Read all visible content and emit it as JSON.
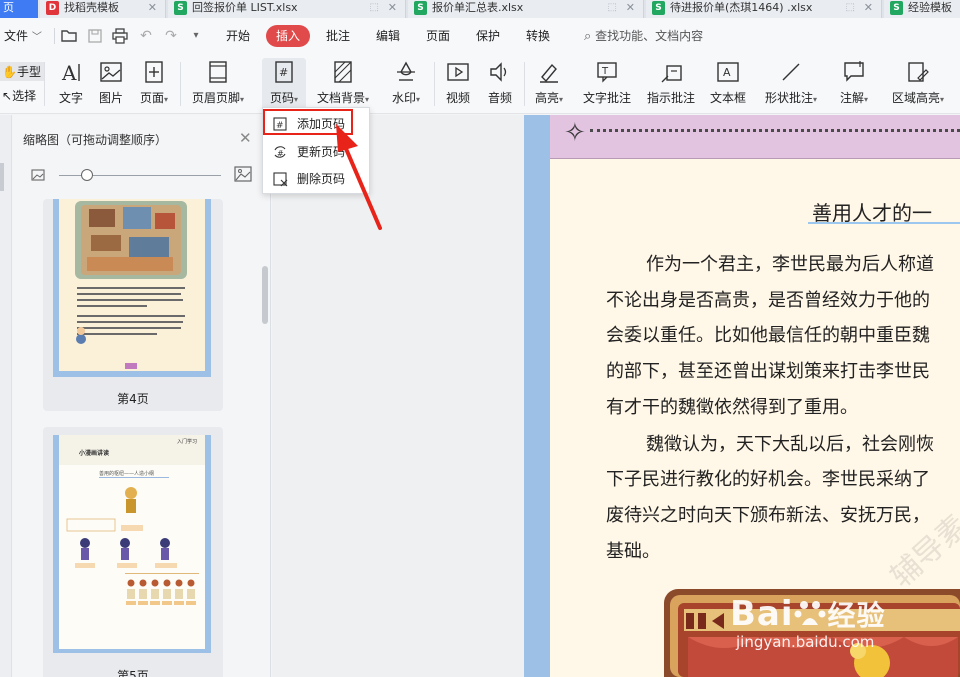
{
  "tabs": {
    "home": "页",
    "documents": [
      {
        "name": "找稻壳模板",
        "icon": "D",
        "color": "#e0363b"
      },
      {
        "name": "回签报价单 LIST.xlsx",
        "icon": "S",
        "color": "#22a760"
      },
      {
        "name": "报价单汇总表.xlsx",
        "icon": "S",
        "color": "#22a760"
      },
      {
        "name": "待进报价单(杰琪1464) .xlsx",
        "icon": "S",
        "color": "#22a760"
      },
      {
        "name": "经验模板",
        "icon": "S",
        "color": "#22a760"
      }
    ]
  },
  "menubar": {
    "file": "文件",
    "tabs": [
      "开始",
      "插入",
      "批注",
      "编辑",
      "页面",
      "保护",
      "转换"
    ],
    "active_tab": "插入",
    "search_placeholder": "查找功能、文档内容"
  },
  "ribbon": {
    "modes": [
      "手型",
      "选择"
    ],
    "buttons": [
      "文字",
      "图片",
      "页面",
      "页眉页脚",
      "页码",
      "文档背景",
      "水印",
      "视频",
      "音频",
      "高亮",
      "文字批注",
      "指示批注",
      "文本框",
      "形状批注",
      "注解",
      "区域高亮"
    ],
    "active": "页码"
  },
  "page_number_menu": {
    "items": [
      "添加页码",
      "更新页码",
      "删除页码"
    ],
    "highlighted": "添加页码"
  },
  "thumbnail_panel": {
    "title": "缩略图（可拖动调整顺序）",
    "pages": [
      {
        "label": "第4页"
      },
      {
        "label": "第5页"
      }
    ]
  },
  "thumb5": {
    "banner": "小漫画讲读",
    "tag": "入门学习",
    "subtitle": "善用的枢纽——人造小纲"
  },
  "document": {
    "title": "善用人才的一",
    "paragraphs": [
      "作为一个君主，李世民最为后人称道",
      "不论出身是否高贵，是否曾经效力于他的",
      "会委以重任。比如他最信任的朝中重臣魏",
      "的部下，甚至还曾出谋划策来打击李世民",
      "有才干的魏徵依然得到了重用。",
      "魏徵认为，天下大乱以后，社会刚恢",
      "下子民进行教化的好机会。李世民采纳了",
      "废待兴之时向天下颁布新法、安抚万民，",
      "基础。"
    ]
  },
  "watermark": {
    "brand": "Bai",
    "brand_cn": "经验",
    "url": "jingyan.baidu.com",
    "side_text": "辅导素"
  },
  "colors": {
    "accent_red": "#e04a4a",
    "highlight_red": "#e8241a",
    "page_margin_blue": "#9cc0e6",
    "header_pink": "#e2c3e0"
  }
}
